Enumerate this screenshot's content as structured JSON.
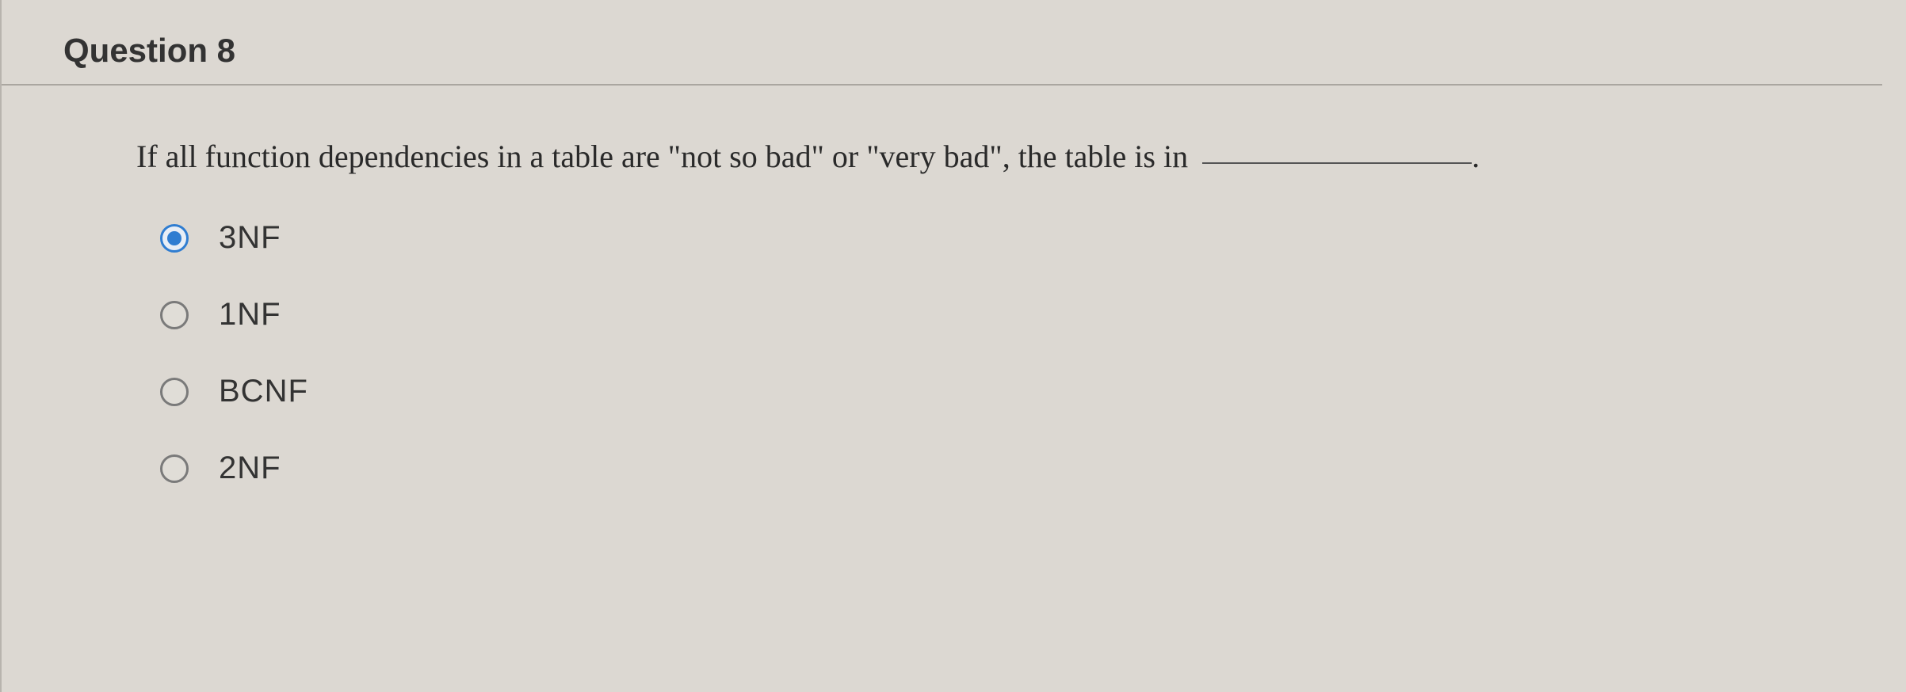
{
  "question": {
    "header": "Question 8",
    "text": "If all function dependencies in a table are \"not so bad\" or \"very bad\", the table is in",
    "options": [
      {
        "label": "3NF",
        "selected": true
      },
      {
        "label": "1NF",
        "selected": false
      },
      {
        "label": "BCNF",
        "selected": false
      },
      {
        "label": "2NF",
        "selected": false
      }
    ]
  }
}
